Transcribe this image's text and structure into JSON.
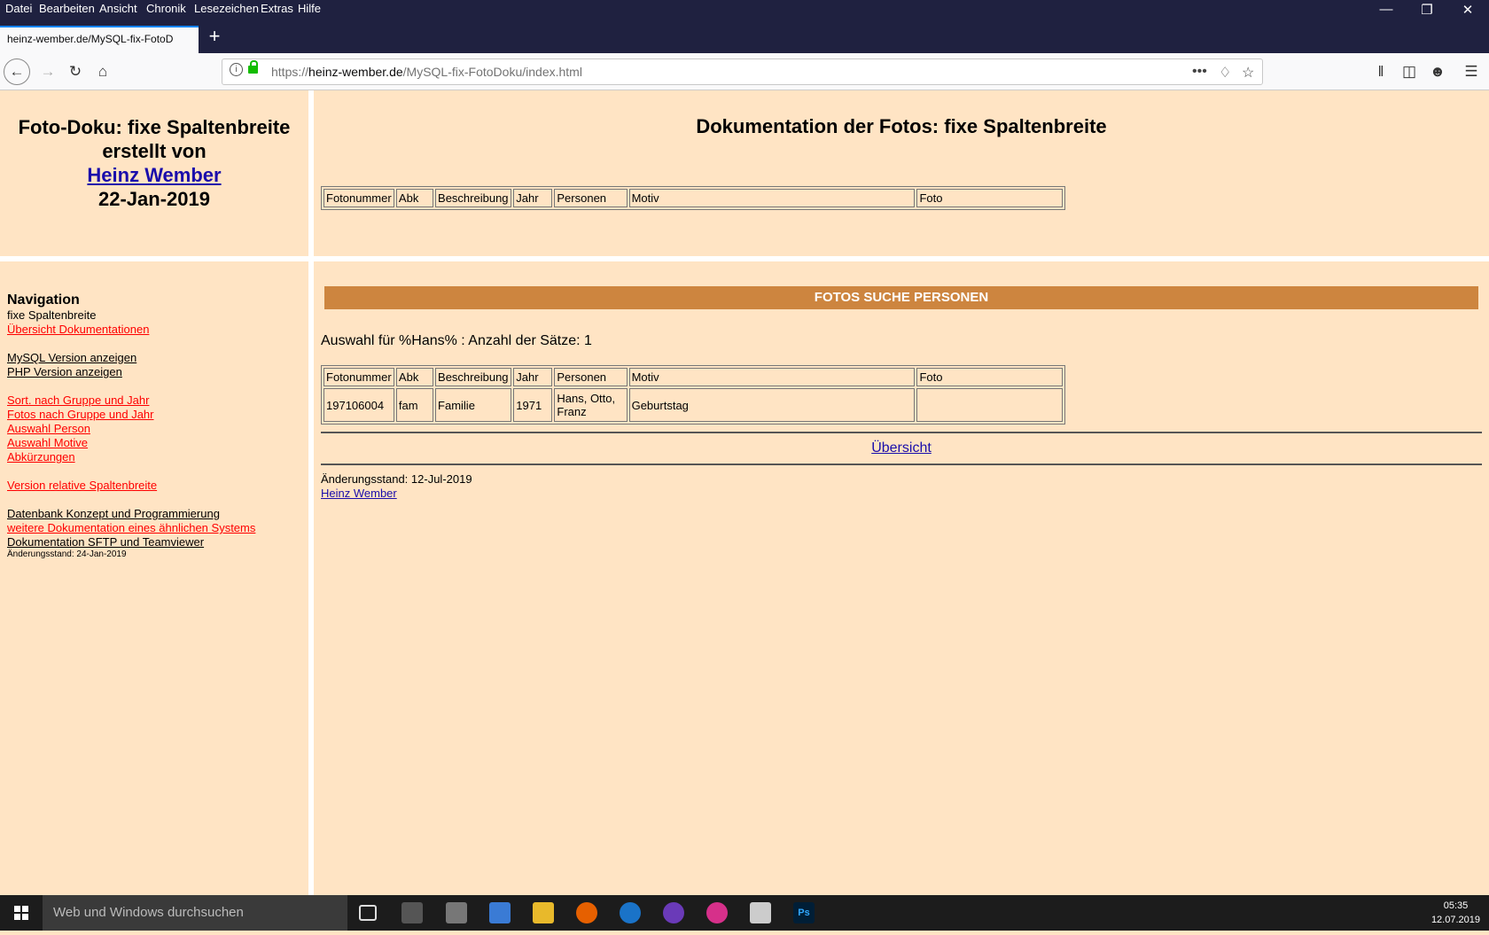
{
  "menu": [
    "Datei",
    "Bearbeiten",
    "Ansicht",
    "Chronik",
    "Lesezeichen",
    "Extras",
    "Hilfe"
  ],
  "tab": {
    "title": "heinz-wember.de/MySQL-fix-FotoD"
  },
  "url": {
    "scheme": "https://",
    "host": "heinz-wember.de",
    "path": "/MySQL-fix-FotoDoku/index.html"
  },
  "header_left": {
    "line1": "Foto-Doku: fixe Spaltenbreite",
    "line2": "erstellt von",
    "author": "Heinz Wember",
    "date": "22-Jan-2019"
  },
  "main_title": "Dokumentation der Fotos: fixe Spaltenbreite",
  "table_headers": [
    "Fotonummer",
    "Abk",
    "Beschreibung",
    "Jahr",
    "Personen",
    "Motiv",
    "Foto"
  ],
  "nav": {
    "heading": "Navigation",
    "current": "fixe Spaltenbreite",
    "overview": "Übersicht Dokumentationen",
    "mysql": "MySQL Version anzeigen",
    "php": "PHP Version anzeigen",
    "sort": "Sort. nach Gruppe und Jahr",
    "fotos": "Fotos nach Gruppe und Jahr",
    "person": "Auswahl Person",
    "motive": "Auswahl Motive",
    "abk": "Abkürzungen",
    "relative": "Version relative Spaltenbreite",
    "db": "Datenbank Konzept und Programmierung",
    "weitere": "weitere Dokumentation eines ähnlichen Systems",
    "sftp": "Dokumentation SFTP und Teamviewer",
    "stand": "Änderungsstand: 24-Jan-2019"
  },
  "banner": "FOTOS SUCHE PERSONEN",
  "auswahl": "Auswahl für %Hans% : Anzahl der Sätze: 1",
  "results": [
    {
      "nr": "197106004",
      "abk": "fam",
      "beschreibung": "Familie",
      "jahr": "1971",
      "personen": "Hans, Otto, Franz",
      "motiv": "Geburtstag",
      "foto": ""
    }
  ],
  "uebersicht": "Übersicht",
  "footer": {
    "stand": "Änderungsstand: 12-Jul-2019",
    "author": "Heinz Wember"
  },
  "taskbar": {
    "search_placeholder": "Web und Windows durchsuchen",
    "time": "05:35",
    "date": "12.07.2019"
  }
}
